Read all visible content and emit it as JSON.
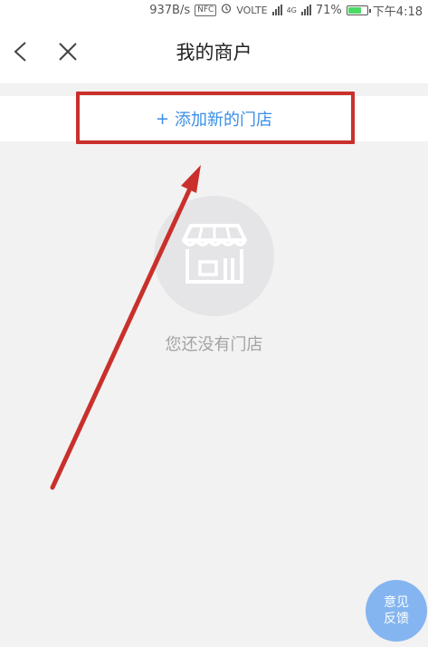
{
  "status_bar": {
    "speed": "937B/s",
    "nfc": "NFC",
    "volte": "VOLTE",
    "signal_4g": "4G",
    "battery": "71%",
    "time": "下午4:18"
  },
  "nav": {
    "title": "我的商户",
    "back_icon": "chevron-left-icon",
    "close_icon": "close-icon"
  },
  "actions": {
    "add_store_prefix": "+",
    "add_store_label": "添加新的门店"
  },
  "empty_state": {
    "icon": "storefront-icon",
    "message": "您还没有门店"
  },
  "feedback": {
    "line1": "意见",
    "line2": "反馈"
  },
  "colors": {
    "accent": "#3a8ee6",
    "highlight": "#c9302c",
    "background": "#f2f2f2",
    "feedback": "#7fb2f0"
  }
}
